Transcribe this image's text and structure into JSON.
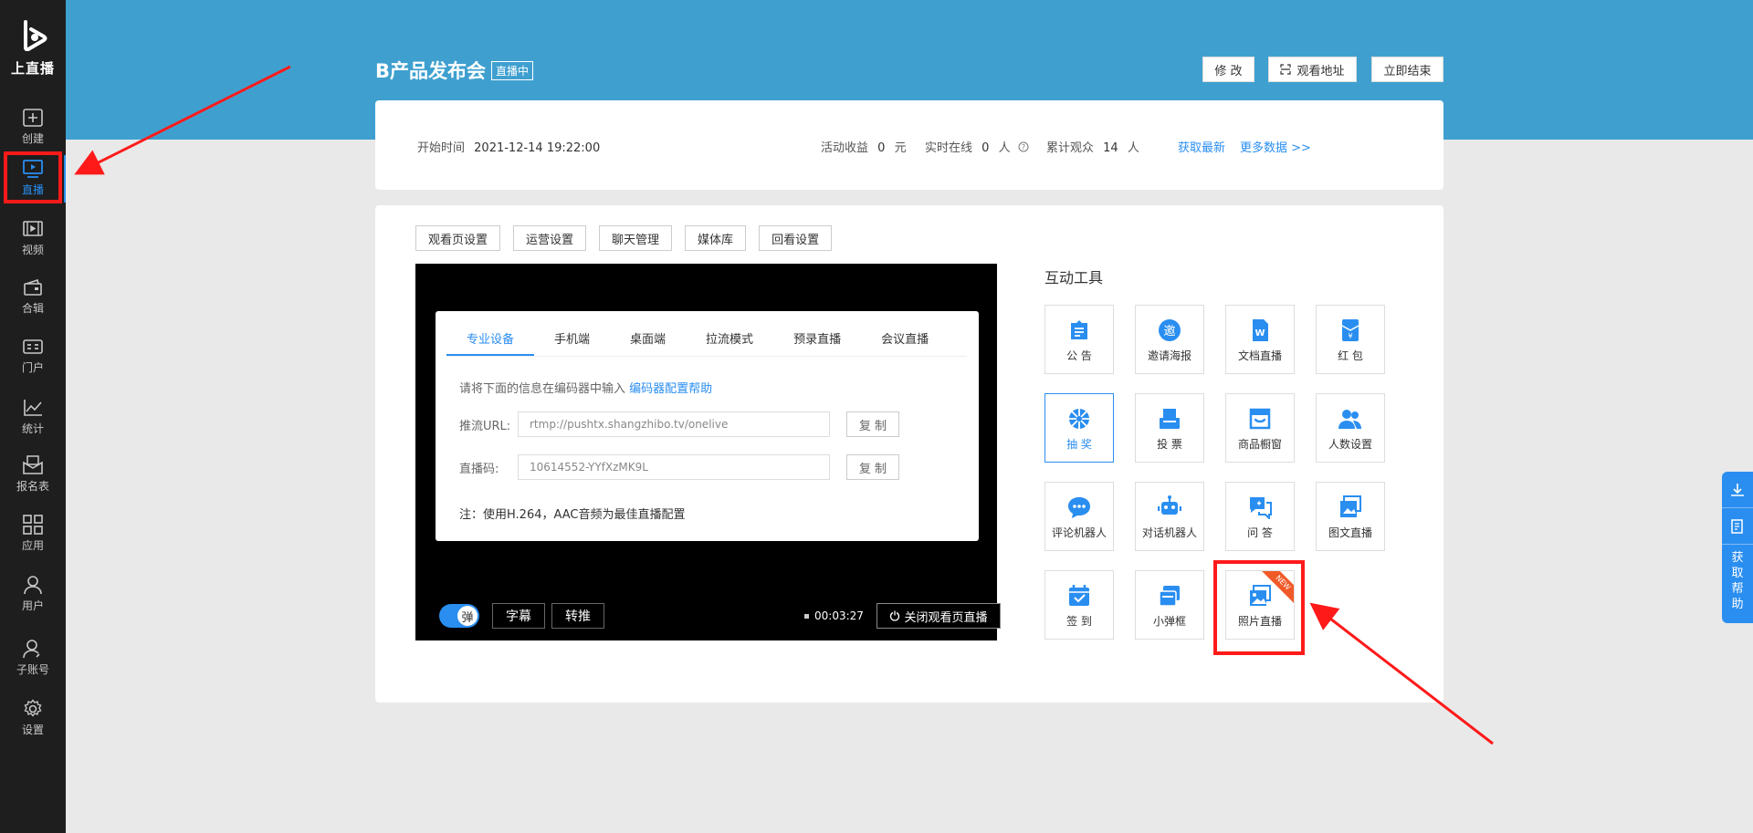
{
  "sidebar": {
    "brand": "上直播",
    "items": [
      {
        "label": "创建",
        "icon": "plus-square-icon"
      },
      {
        "label": "直播",
        "icon": "live-tv-icon"
      },
      {
        "label": "视频",
        "icon": "video-icon"
      },
      {
        "label": "合辑",
        "icon": "collection-icon"
      },
      {
        "label": "门户",
        "icon": "portal-icon"
      },
      {
        "label": "统计",
        "icon": "chart-icon"
      },
      {
        "label": "报名表",
        "icon": "form-icon"
      },
      {
        "label": "应用",
        "icon": "apps-icon"
      },
      {
        "label": "用户",
        "icon": "user-icon"
      },
      {
        "label": "子账号",
        "icon": "subaccount-icon"
      },
      {
        "label": "设置",
        "icon": "gear-icon"
      }
    ]
  },
  "header": {
    "title": "B产品发布会",
    "badge": "直播中",
    "buttons": {
      "edit": "修 改",
      "watch_url": "观看地址",
      "end": "立即结束"
    }
  },
  "info": {
    "start_label": "开始时间",
    "start_time": "2021-12-14 19:22:00",
    "revenue_label": "活动收益",
    "revenue_value": "0",
    "revenue_unit": "元",
    "online_label": "实时在线",
    "online_value": "0",
    "online_unit": "人",
    "total_label": "累计观众",
    "total_value": "14",
    "total_unit": "人",
    "refresh": "获取最新",
    "more": "更多数据 >>"
  },
  "settings_tabs": [
    "观看页设置",
    "运营设置",
    "聊天管理",
    "媒体库",
    "回看设置"
  ],
  "player": {
    "tabs": [
      "专业设备",
      "手机端",
      "桌面端",
      "拉流模式",
      "预录直播",
      "会议直播"
    ],
    "hint": "请将下面的信息在编码器中输入",
    "hint_link": "编码器配置帮助",
    "url_label": "推流URL:",
    "url_value": "rtmp://pushtx.shangzhibo.tv/onelive",
    "code_label": "直播码:",
    "code_value": "10614552-YYfXzMK9L",
    "copy": "复 制",
    "note": "注：使用H.264，AAC音频为最佳直播配置",
    "toggle": "弹",
    "subtitle": "字幕",
    "relay": "转推",
    "timer": "00:03:27",
    "close": "关闭观看页直播"
  },
  "tools": {
    "title": "互动工具",
    "new_badge": "NEW",
    "items": [
      {
        "label": "公 告",
        "icon": "announcement-icon"
      },
      {
        "label": "邀请海报",
        "icon": "invite-poster-icon"
      },
      {
        "label": "文档直播",
        "icon": "document-live-icon"
      },
      {
        "label": "红 包",
        "icon": "red-packet-icon"
      },
      {
        "label": "抽 奖",
        "icon": "lottery-icon"
      },
      {
        "label": "投 票",
        "icon": "vote-icon"
      },
      {
        "label": "商品橱窗",
        "icon": "shop-window-icon"
      },
      {
        "label": "人数设置",
        "icon": "people-icon"
      },
      {
        "label": "评论机器人",
        "icon": "comment-bot-icon"
      },
      {
        "label": "对话机器人",
        "icon": "chat-bot-icon"
      },
      {
        "label": "问 答",
        "icon": "qa-icon"
      },
      {
        "label": "图文直播",
        "icon": "image-text-icon"
      },
      {
        "label": "签 到",
        "icon": "checkin-icon"
      },
      {
        "label": "小弹框",
        "icon": "popup-icon"
      },
      {
        "label": "照片直播",
        "icon": "photo-live-icon"
      }
    ]
  },
  "helper": {
    "text": "获取帮助"
  },
  "colors": {
    "accent": "#2a8ef0",
    "banner": "#3fa0d0",
    "sidebar": "#1e1e1e",
    "highlight": "#ff1a1a"
  }
}
